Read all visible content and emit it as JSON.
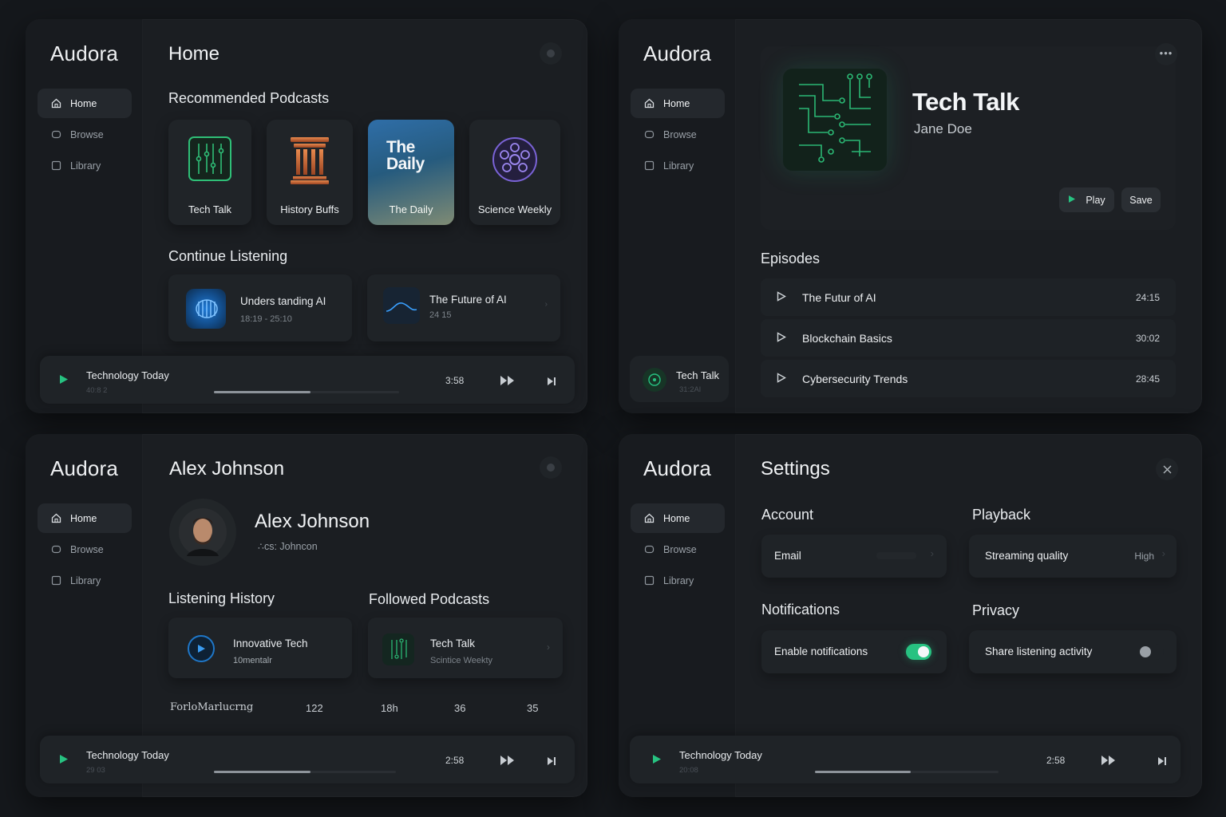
{
  "app": {
    "brand": "Audora"
  },
  "nav": {
    "home": "Home",
    "browse": "Browse",
    "library": "Library"
  },
  "home_screen": {
    "title": "Home",
    "recommended_title": "Recommended Podcasts",
    "podcasts": [
      {
        "label": "Tech Talk"
      },
      {
        "label": "History Buffs"
      },
      {
        "label": "The Daily",
        "cover_text_1": "The",
        "cover_text_2": "Daily"
      },
      {
        "label": "Science Weekly"
      }
    ],
    "continue_title": "Continue Listening",
    "continue": [
      {
        "title": "Unders tanding AI",
        "sub": "18:19 - 25:10"
      },
      {
        "title": "The Future of AI",
        "sub": "24 15"
      }
    ],
    "player": {
      "title": "Technology Today",
      "sub": "40:8 2",
      "time": "3:58",
      "progress": 0.52
    }
  },
  "detail_screen": {
    "title": "Tech Talk",
    "author": "Jane Doe",
    "play_label": "Play",
    "save_label": "Save",
    "episodes_title": "Episodes",
    "episodes": [
      {
        "title": "The Futur of AI",
        "duration": "24:15"
      },
      {
        "title": "Blockchain Basics",
        "duration": "30:02"
      },
      {
        "title": "Cybersecurity Trends",
        "duration": "28:45"
      }
    ],
    "mini_player": {
      "title": "Tech Talk",
      "sub": "31:2Al"
    }
  },
  "profile_screen": {
    "title": "Alex Johnson",
    "name": "Alex Johnson",
    "handle": "∴cs: Johncon",
    "history_title": "Listening History",
    "followed_title": "Followed Podcasts",
    "history_item": {
      "title": "Innovative Tech",
      "sub": "10mentalr"
    },
    "followed_item": {
      "title": "Tech Talk",
      "sub": "Scintice Weekty"
    },
    "stats": [
      "ForloMarlucrng",
      "122",
      "18h",
      "36",
      "35"
    ],
    "player": {
      "title": "Technology Today",
      "sub": "29 03",
      "time": "2:58",
      "progress": 0.53
    }
  },
  "settings_screen": {
    "title": "Settings",
    "account_title": "Account",
    "email_label": "Email",
    "playback_title": "Playback",
    "streaming_label": "Streaming quality",
    "streaming_value": "High",
    "notifications_title": "Notifications",
    "enable_notifications_label": "Enable notifications",
    "enable_notifications_on": true,
    "privacy_title": "Privacy",
    "share_activity_label": "Share listening activity",
    "share_activity_on": false,
    "player": {
      "title": "Technology Today",
      "sub": "20:08",
      "time": "2:58",
      "progress": 0.52
    }
  },
  "colors": {
    "accent": "#27c281",
    "panel": "#1b1e22",
    "background": "#15181c"
  }
}
